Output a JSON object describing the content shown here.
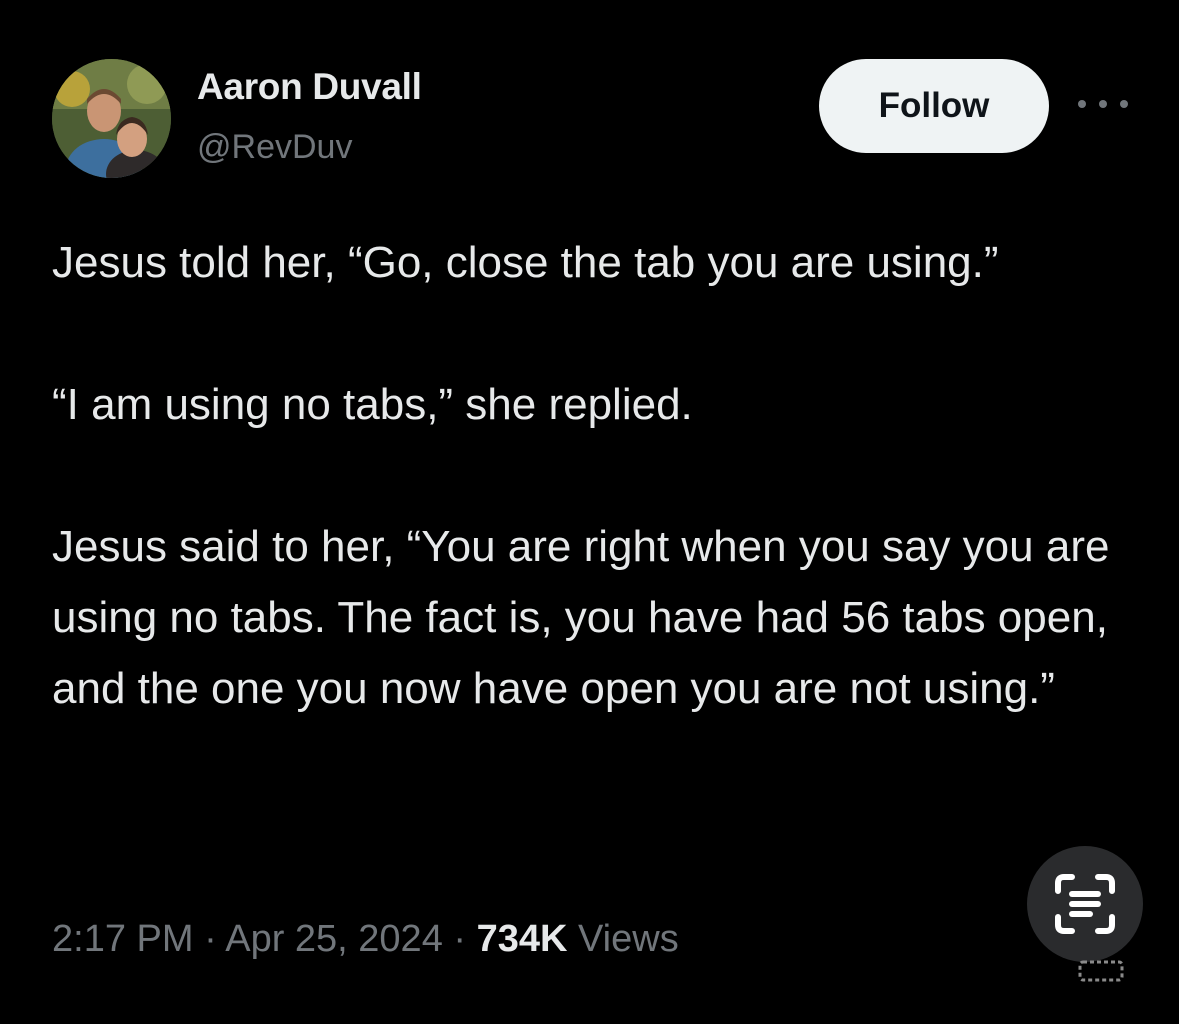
{
  "author": {
    "display_name": "Aaron Duvall",
    "handle": "@RevDuv",
    "avatar_icon": "profile-photo"
  },
  "actions": {
    "follow_label": "Follow",
    "more_icon": "more-horizontal-icon"
  },
  "tweet": {
    "paragraphs": [
      "Jesus  told her, “Go, close the tab you are using.”",
      "“I am using no tabs,” she replied.",
      "Jesus said to her, “You are right when you say you are using no tabs. The fact is, you have had 56 tabs open, and the one you now have open you are not using.”"
    ]
  },
  "meta": {
    "time": "2:17 PM",
    "separator": " · ",
    "date": "Apr 25, 2024",
    "views_count": "734K",
    "views_label": "Views"
  },
  "overlay": {
    "lens_icon": "text-scan-icon"
  },
  "colors": {
    "background": "#000000",
    "primary_text": "#e7e9ea",
    "secondary_text": "#71767b",
    "follow_bg": "#eff3f4",
    "follow_text": "#0f1419"
  }
}
